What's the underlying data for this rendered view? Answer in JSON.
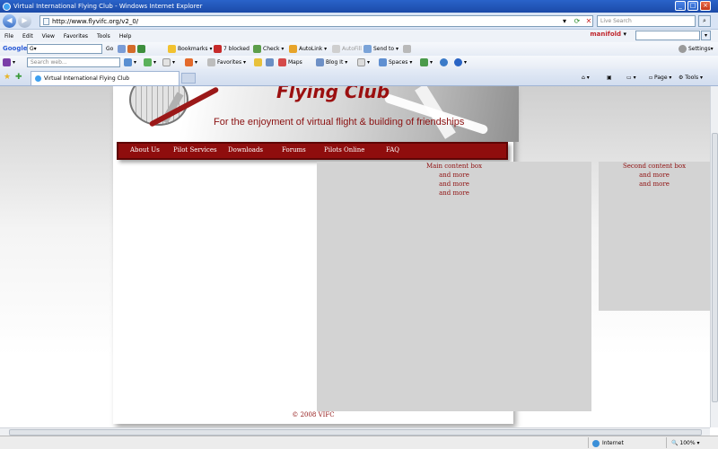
{
  "window": {
    "title": "Virtual International Flying Club - Windows Internet Explorer",
    "min": "_",
    "max": "□",
    "close": "×"
  },
  "address": {
    "url": "http://www.flyvifc.org/v2_0/",
    "live_search_placeholder": "Live Search"
  },
  "menu": {
    "items": [
      "File",
      "Edit",
      "View",
      "Favorites",
      "Tools",
      "Help"
    ],
    "manifold_label": "manifold"
  },
  "google_toolbar": {
    "label": "Google",
    "go": "Go",
    "bookmarks": "Bookmarks",
    "blocked": "7 blocked",
    "check": "Check",
    "autolink": "AutoLink",
    "autofill": "AutoFill",
    "send_to": "Send to",
    "settings": "Settings"
  },
  "yahoo_toolbar": {
    "search_placeholder": "Search web...",
    "favorites": "Favorites",
    "maps": "Maps",
    "blog_it": "Blog It",
    "spaces": "Spaces"
  },
  "tabs": {
    "active": "Virtual International Flying Club",
    "page": "Page",
    "tools": "Tools"
  },
  "site": {
    "title": "Flying Club",
    "tagline": "For the enjoyment of virtual flight & building of friendships",
    "nav": [
      "About Us",
      "Pilot Services",
      "Downloads",
      "Forums",
      "Pilots Online",
      "FAQ"
    ],
    "main_box": [
      "Main content box",
      "and more",
      "and more",
      "and more"
    ],
    "side_box": [
      "Second content box",
      "and more",
      "and more"
    ],
    "copyright": "© 2008 VIFC"
  },
  "status": {
    "zone": "Internet",
    "zoom": "100%"
  }
}
